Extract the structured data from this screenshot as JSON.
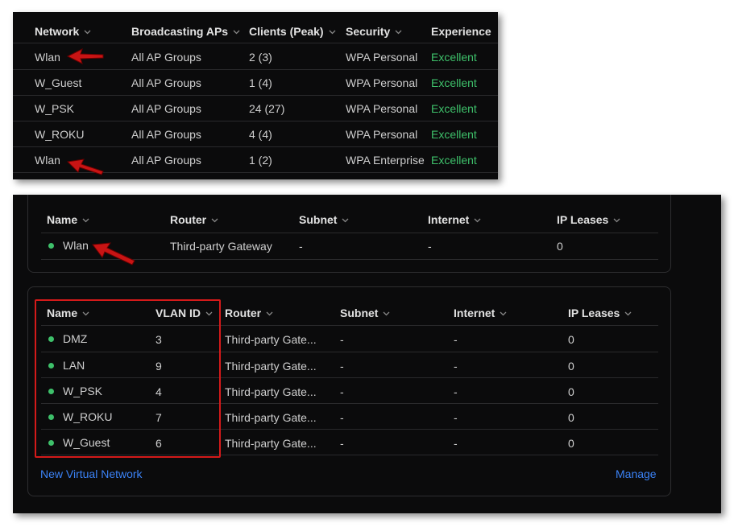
{
  "wifi_table": {
    "columns": [
      "Network",
      "Broadcasting APs",
      "Clients (Peak)",
      "Security",
      "Experience"
    ],
    "rows": [
      {
        "network": "Wlan",
        "aps": "All AP Groups",
        "clients": "2 (3)",
        "security": "WPA Personal",
        "experience": "Excellent"
      },
      {
        "network": "W_Guest",
        "aps": "All AP Groups",
        "clients": "1 (4)",
        "security": "WPA Personal",
        "experience": "Excellent"
      },
      {
        "network": "W_PSK",
        "aps": "All AP Groups",
        "clients": "24 (27)",
        "security": "WPA Personal",
        "experience": "Excellent"
      },
      {
        "network": "W_ROKU",
        "aps": "All AP Groups",
        "clients": "4 (4)",
        "security": "WPA Personal",
        "experience": "Excellent"
      },
      {
        "network": "Wlan",
        "aps": "All AP Groups",
        "clients": "1 (2)",
        "security": "WPA Enterprise",
        "experience": "Excellent"
      }
    ]
  },
  "gateway_table": {
    "columns": [
      "Name",
      "Router",
      "Subnet",
      "Internet",
      "IP Leases"
    ],
    "rows": [
      {
        "name": "Wlan",
        "router": "Third-party Gateway",
        "subnet": "-",
        "internet": "-",
        "leases": "0"
      }
    ]
  },
  "vlan_table": {
    "columns": [
      "Name",
      "VLAN ID",
      "Router",
      "Subnet",
      "Internet",
      "IP Leases"
    ],
    "rows": [
      {
        "name": "DMZ",
        "vlan": "3",
        "router": "Third-party Gate...",
        "subnet": "-",
        "internet": "-",
        "leases": "0"
      },
      {
        "name": "LAN",
        "vlan": "9",
        "router": "Third-party Gate...",
        "subnet": "-",
        "internet": "-",
        "leases": "0"
      },
      {
        "name": "W_PSK",
        "vlan": "4",
        "router": "Third-party Gate...",
        "subnet": "-",
        "internet": "-",
        "leases": "0"
      },
      {
        "name": "W_ROKU",
        "vlan": "7",
        "router": "Third-party Gate...",
        "subnet": "-",
        "internet": "-",
        "leases": "0"
      },
      {
        "name": "W_Guest",
        "vlan": "6",
        "router": "Third-party Gate...",
        "subnet": "-",
        "internet": "-",
        "leases": "0"
      }
    ],
    "new_link": "New Virtual Network",
    "manage_link": "Manage"
  },
  "colors": {
    "status_green": "#3ec06a",
    "link_blue": "#3b82f6",
    "highlight_red": "#d41a1a"
  },
  "icons": [
    "chevron-down-icon",
    "status-dot-icon",
    "red-arrow-annotation"
  ]
}
